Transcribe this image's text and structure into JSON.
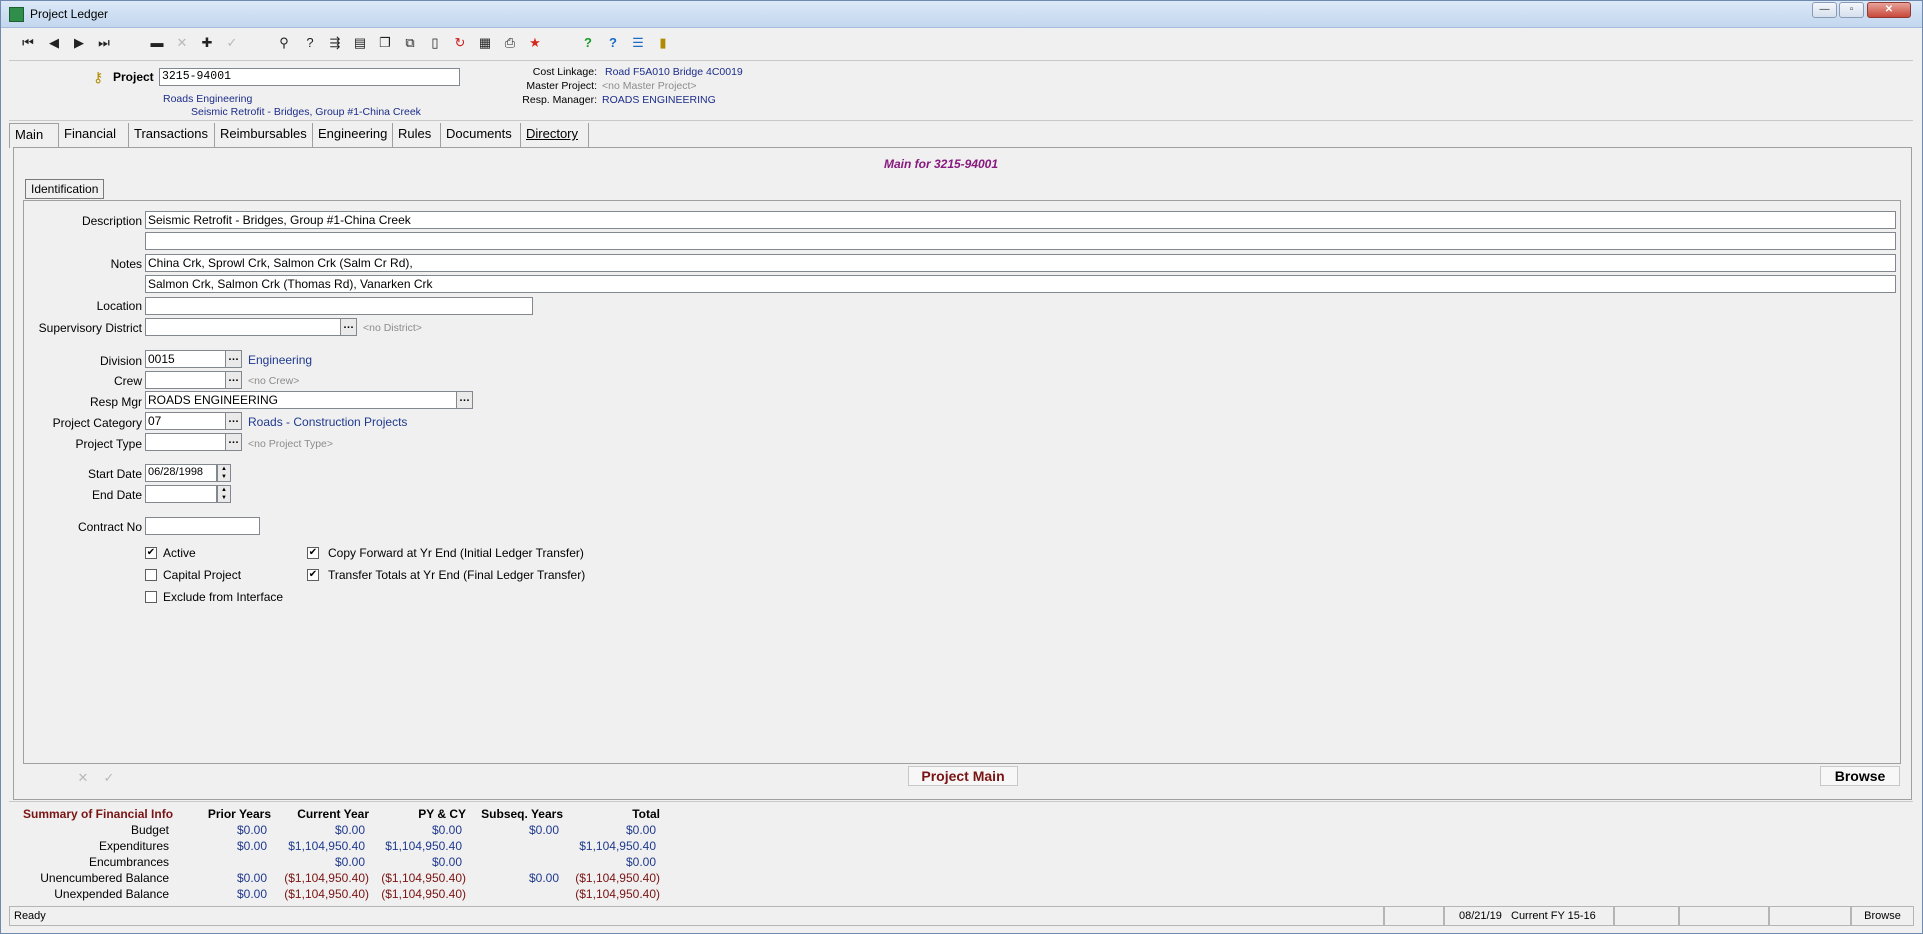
{
  "window": {
    "title": "Project Ledger",
    "min": "—",
    "max": "▫",
    "close": "✕"
  },
  "header": {
    "project_label": "Project",
    "project_value": "3215-94001",
    "dept": "Roads Engineering",
    "desc": "Seismic Retrofit - Bridges, Group #1-China Creek",
    "cost_linkage_label": "Cost Linkage:",
    "cost_linkage_value": "Road F5A010 Bridge 4C0019",
    "master_project_label": "Master Project:",
    "master_project_value": "<no Master Project>",
    "resp_manager_label": "Resp. Manager:",
    "resp_manager_value": "ROADS ENGINEERING"
  },
  "tabs": [
    "Main",
    "Financial",
    "Transactions",
    "Reimbursables",
    "Engineering",
    "Rules",
    "Documents",
    "Directory"
  ],
  "main": {
    "heading": "Main for  3215-94001",
    "subtab": "Identification",
    "description_label": "Description",
    "description_1": "Seismic Retrofit - Bridges, Group #1-China Creek",
    "description_2": "",
    "notes_label": "Notes",
    "notes_1": "China Crk, Sprowl Crk, Salmon Crk (Salm Cr Rd),",
    "notes_2": "Salmon Crk, Salmon Crk (Thomas Rd), Vanarken Crk",
    "location_label": "Location",
    "location_value": "",
    "supdist_label": "Supervisory District",
    "supdist_value": "",
    "supdist_desc": "<no District>",
    "division_label": "Division",
    "division_value": "0015",
    "division_desc": "Engineering",
    "crew_label": "Crew",
    "crew_value": "",
    "crew_desc": "<no Crew>",
    "respmgr_label": "Resp Mgr",
    "respmgr_value": "ROADS ENGINEERING",
    "category_label": "Project Category",
    "category_value": "07",
    "category_desc": "Roads - Construction Projects",
    "type_label": "Project Type",
    "type_value": "",
    "type_desc": "<no Project Type>",
    "start_label": "Start Date",
    "start_value": "06/28/1998",
    "end_label": "End Date",
    "end_value": "",
    "contract_label": "Contract No",
    "contract_value": "",
    "active_label": "Active",
    "active_checked": true,
    "capital_label": "Capital Project",
    "capital_checked": false,
    "exclude_label": "Exclude from Interface",
    "exclude_checked": false,
    "copyfwd_label": "Copy Forward at Yr End (Initial Ledger Transfer)",
    "copyfwd_checked": true,
    "transfer_label": "Transfer Totals at Yr End (Final Ledger Transfer)",
    "transfer_checked": true,
    "footer_title": "Project Main",
    "footer_mode": "Browse"
  },
  "summary": {
    "title": "Summary of Financial Info",
    "columns": [
      "Prior Years",
      "Current Year",
      "PY & CY",
      "Subseq. Years",
      "Total"
    ],
    "rows": [
      {
        "label": "Budget",
        "values": [
          "$0.00",
          "$0.00",
          "$0.00",
          "$0.00",
          "$0.00"
        ]
      },
      {
        "label": "Expenditures",
        "values": [
          "$0.00",
          "$1,104,950.40",
          "$1,104,950.40",
          "",
          "$1,104,950.40"
        ]
      },
      {
        "label": "Encumbrances",
        "values": [
          "",
          "$0.00",
          "$0.00",
          "",
          "$0.00"
        ]
      },
      {
        "label": "Unencumbered Balance",
        "values": [
          "$0.00",
          "($1,104,950.40)",
          "($1,104,950.40)",
          "$0.00",
          "($1,104,950.40)"
        ]
      },
      {
        "label": "Unexpended Balance",
        "values": [
          "$0.00",
          "($1,104,950.40)",
          "($1,104,950.40)",
          "",
          "($1,104,950.40)"
        ]
      }
    ]
  },
  "status": {
    "ready": "Ready",
    "date": "08/21/19",
    "fy": "Current FY 15-16",
    "mode": "Browse"
  },
  "colors": {
    "navy": "#1c2d8a",
    "maroon": "#7a1414",
    "purple": "#86197e"
  }
}
